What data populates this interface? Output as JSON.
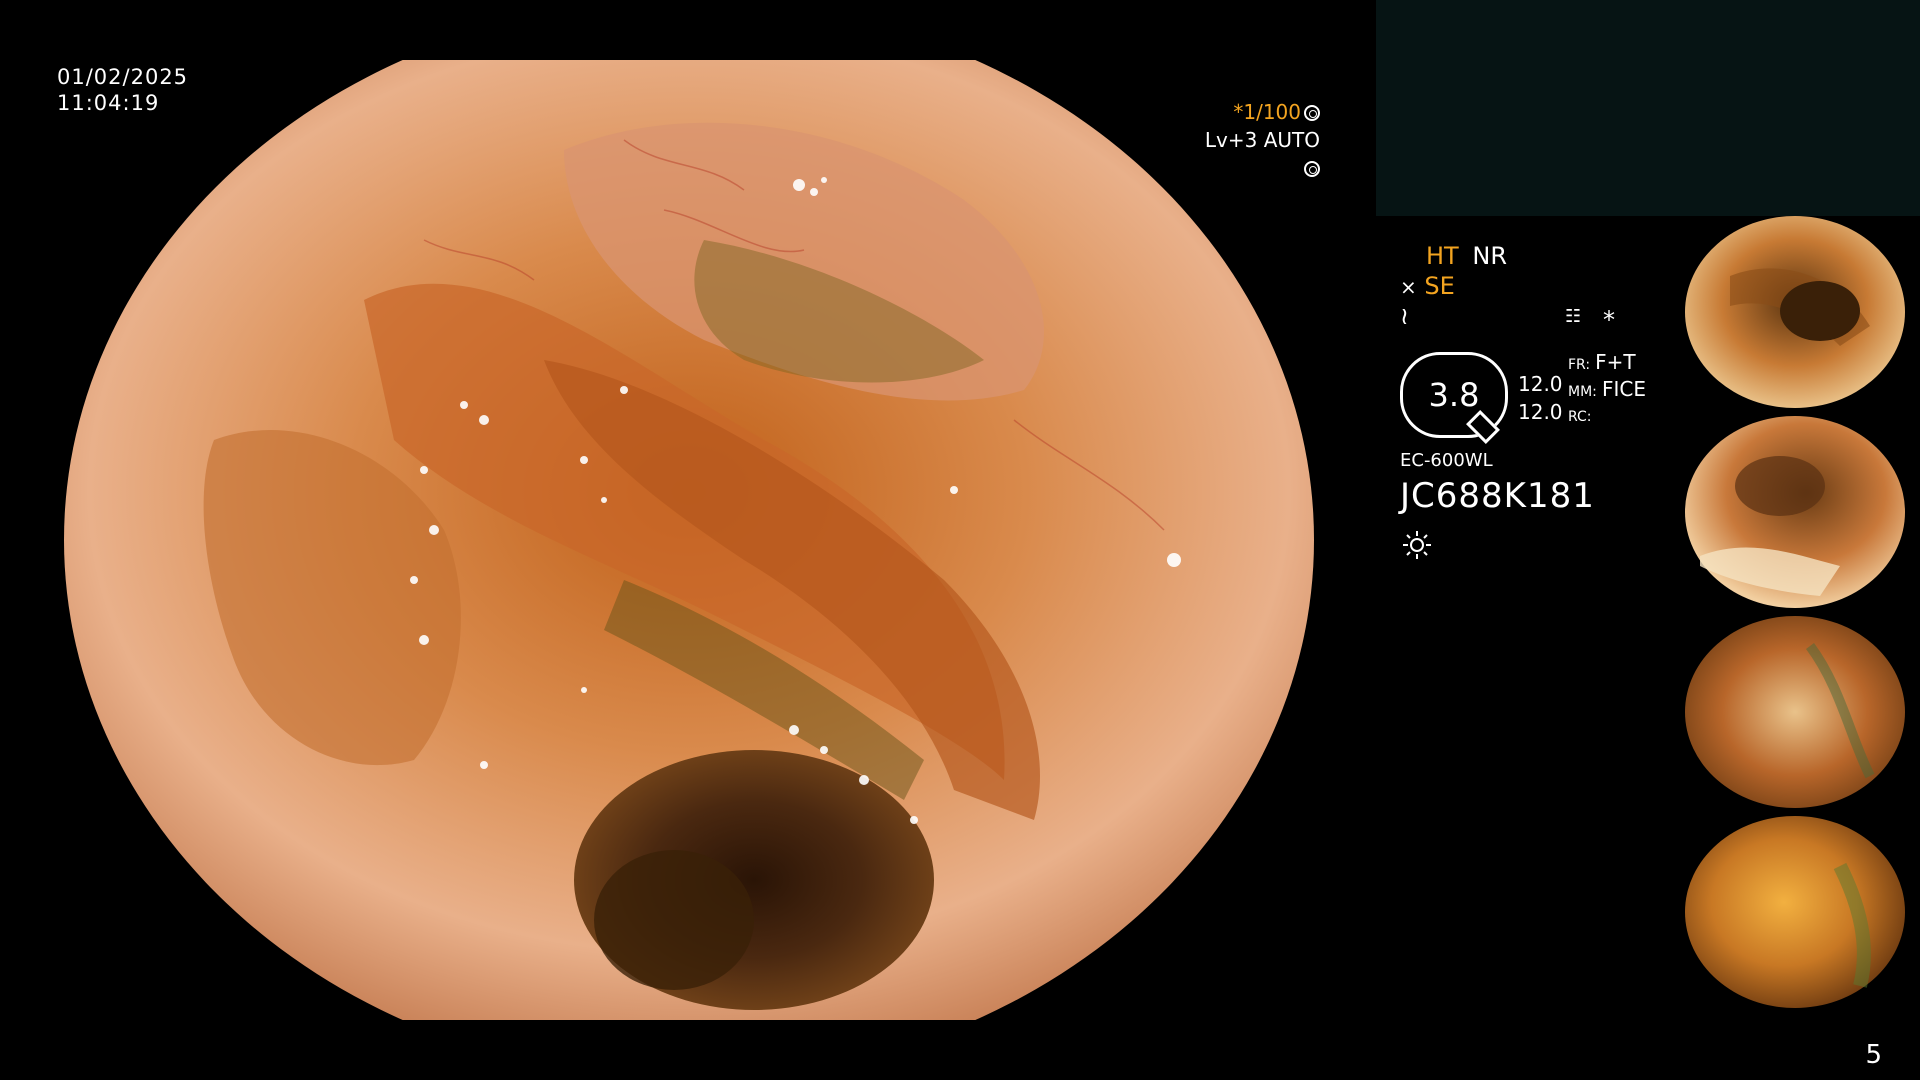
{
  "overlay": {
    "date": "01/02/2025",
    "time": "11:04:19",
    "shutter": "*1/100",
    "level": "Lv+3 AUTO"
  },
  "panel": {
    "ht": "HT",
    "nr": "NR",
    "se": "SE",
    "ratio": "3.8",
    "val1": "12.0",
    "val2": "12.0",
    "fr_label": "FR:",
    "fr_value": "F+T",
    "mm_label": "MM:",
    "mm_value": "FICE",
    "rc_label": "RC:",
    "star": "*",
    "model": "EC-600WL",
    "serial": "JC688K181"
  },
  "page_number": "5",
  "colors": {
    "highlight": "#f3a420",
    "tissue": "#d9874a",
    "panel_bg": "#061414"
  }
}
